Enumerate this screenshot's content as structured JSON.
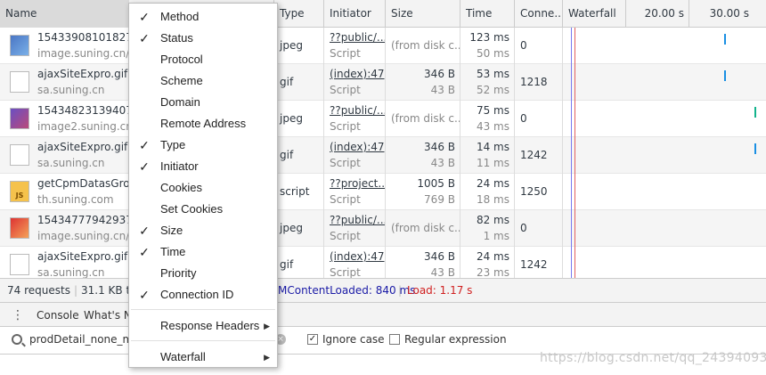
{
  "columns": {
    "name": "Name",
    "type": "Type",
    "initiator": "Initiator",
    "size": "Size",
    "time": "Time",
    "connection": "Conne...",
    "waterfall": "Waterfall",
    "wf_tick1": "20.00 s",
    "wf_tick2": "30.00 s"
  },
  "rows": [
    {
      "name": "1543390810182731",
      "domain": "image.suning.cn/ui",
      "type": "jpeg",
      "initiator": "??public/...",
      "initiator_sub": "Script",
      "size": "(from disk c...",
      "time": "123 ms",
      "latency": "50 ms",
      "connection": "0"
    },
    {
      "name": "ajaxSiteExpro.gif?ol",
      "domain": "sa.suning.cn",
      "type": "gif",
      "initiator": "(index):47",
      "initiator_sub": "Script",
      "size": "346 B",
      "size_sub": "43 B",
      "time": "53 ms",
      "latency": "52 ms",
      "connection": "1218"
    },
    {
      "name": "1543482313940768",
      "domain": "image2.suning.cn/ui",
      "type": "jpeg",
      "initiator": "??public/...",
      "initiator_sub": "Script",
      "size": "(from disk c...",
      "time": "75 ms",
      "latency": "43 ms",
      "connection": "0"
    },
    {
      "name": "ajaxSiteExpro.gif?ol",
      "domain": "sa.suning.cn",
      "type": "gif",
      "initiator": "(index):47",
      "initiator_sub": "Script",
      "size": "346 B",
      "size_sub": "43 B",
      "time": "14 ms",
      "latency": "11 ms",
      "connection": "1242"
    },
    {
      "name": "getCpmDatasGroup",
      "domain": "th.suning.com",
      "type": "script",
      "initiator": "??project...",
      "initiator_sub": "Script",
      "size": "1005 B",
      "size_sub": "769 B",
      "time": "24 ms",
      "latency": "18 ms",
      "connection": "1250"
    },
    {
      "name": "1543477794293797",
      "domain": "image.suning.cn/ui",
      "type": "jpeg",
      "initiator": "??public/...",
      "initiator_sub": "Script",
      "size": "(from disk c...",
      "time": "82 ms",
      "latency": "1 ms",
      "connection": "0"
    },
    {
      "name": "ajaxSiteExpro.gif?ol",
      "domain": "sa.suning.cn",
      "type": "gif",
      "initiator": "(index):47",
      "initiator_sub": "Script",
      "size": "346 B",
      "size_sub": "43 B",
      "time": "24 ms",
      "latency": "23 ms",
      "connection": "1242"
    }
  ],
  "icons": [
    "image-thumbnail-icon",
    "file-icon",
    "image-thumbnail-icon",
    "file-icon",
    "js-file-icon",
    "image-thumbnail-icon",
    "file-icon"
  ],
  "summary": {
    "requests": "74 requests",
    "transferred": "31.1 KB tra",
    "dcl": "MContentLoaded: 840 ms",
    "load": "Load: 1.17 s",
    "dcl_color": "#1a1aa6",
    "load_color": "#d02020"
  },
  "drawer": {
    "console": "Console",
    "whats_new": "What's N"
  },
  "search": {
    "value": "prodDetail_none_mai",
    "ignore_case": "Ignore case",
    "regex": "Regular expression"
  },
  "menu": {
    "items": [
      {
        "label": "Method",
        "checked": "✓"
      },
      {
        "label": "Status",
        "checked": "✓"
      },
      {
        "label": "Protocol",
        "checked": ""
      },
      {
        "label": "Scheme",
        "checked": ""
      },
      {
        "label": "Domain",
        "checked": ""
      },
      {
        "label": "Remote Address",
        "checked": ""
      },
      {
        "label": "Type",
        "checked": "✓"
      },
      {
        "label": "Initiator",
        "checked": "✓"
      },
      {
        "label": "Cookies",
        "checked": ""
      },
      {
        "label": "Set Cookies",
        "checked": ""
      },
      {
        "label": "Size",
        "checked": "✓"
      },
      {
        "label": "Time",
        "checked": "✓"
      },
      {
        "label": "Priority",
        "checked": ""
      },
      {
        "label": "Connection ID",
        "checked": "✓"
      }
    ],
    "response_headers": "Response Headers",
    "waterfall": "Waterfall"
  },
  "watermark": "https://blog.csdn.net/qq_24394093"
}
